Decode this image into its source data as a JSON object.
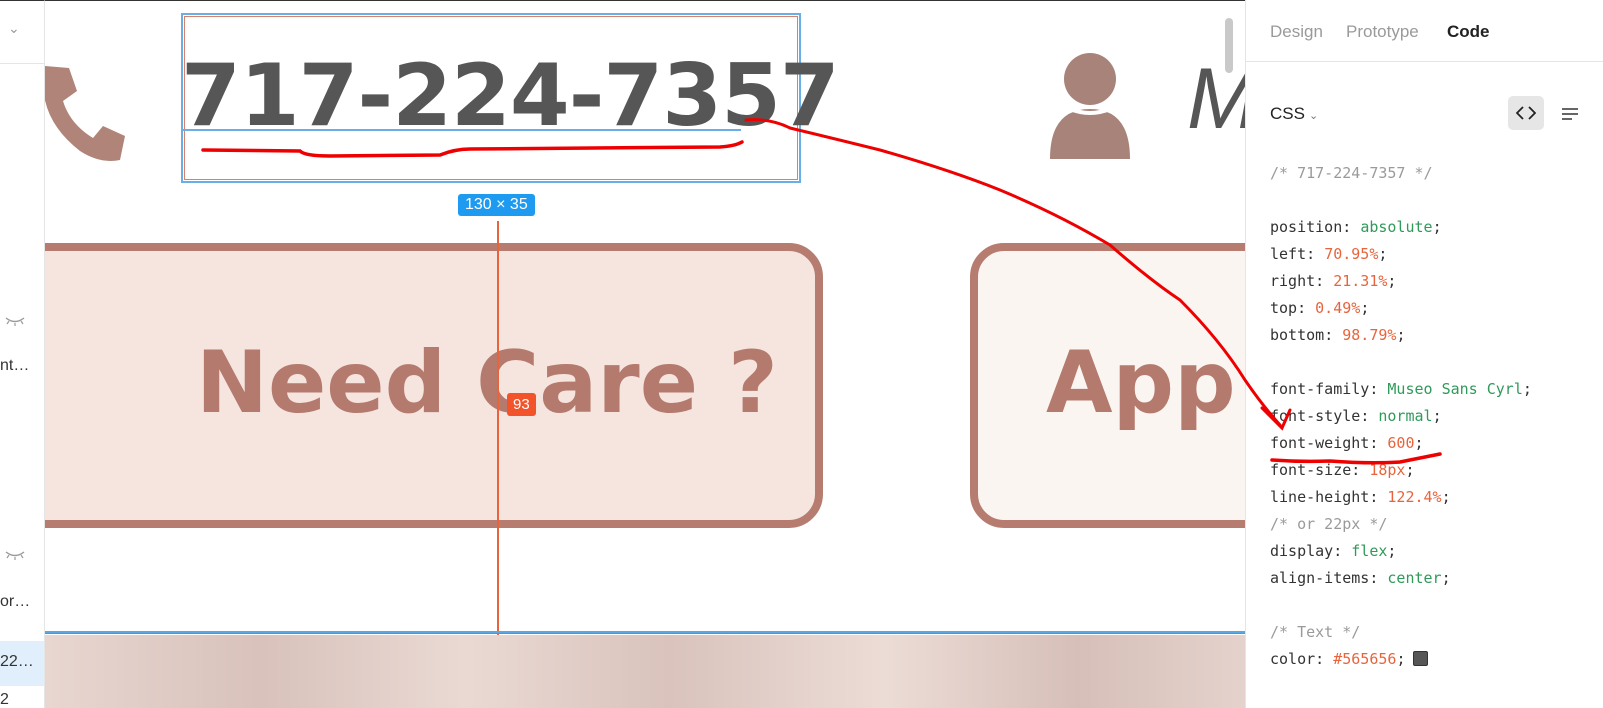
{
  "layers_panel": {
    "items": [
      "nt…",
      "or…",
      "22…",
      "2"
    ]
  },
  "canvas": {
    "phone_number": "717-224-7357",
    "size_badge": "130 × 35",
    "distance_badge": "93",
    "card_need_text": "Need Care ?",
    "card_app_text": "App",
    "cut_letter": "M"
  },
  "inspector": {
    "tabs": [
      {
        "label": "Design",
        "active": false
      },
      {
        "label": "Prototype",
        "active": false
      },
      {
        "label": "Code",
        "active": true
      }
    ],
    "language": "CSS",
    "code": {
      "comment_name": "/* 717-224-7357 */",
      "position": {
        "prop": "position",
        "value": "absolute"
      },
      "left": {
        "prop": "left",
        "value": "70.95%"
      },
      "right": {
        "prop": "right",
        "value": "21.31%"
      },
      "top": {
        "prop": "top",
        "value": "0.49%"
      },
      "bottom": {
        "prop": "bottom",
        "value": "98.79%"
      },
      "font_family": {
        "prop": "font-family",
        "value": "Museo Sans Cyrl"
      },
      "font_style": {
        "prop": "font-style",
        "value": "normal"
      },
      "font_weight": {
        "prop": "font-weight",
        "value": "600"
      },
      "font_size": {
        "prop": "font-size",
        "value": "18px"
      },
      "line_height": {
        "prop": "line-height",
        "value": "122.4%"
      },
      "comment_px": "/* or 22px */",
      "display": {
        "prop": "display",
        "value": "flex"
      },
      "align_items": {
        "prop": "align-items",
        "value": "center"
      },
      "comment_text": "/* Text */",
      "color": {
        "prop": "color",
        "value": "#565656"
      }
    }
  },
  "colors": {
    "text_gray": "#565656",
    "accent_brown": "#b57c6f",
    "selection_blue": "#1e9bf0",
    "measure_orange": "#f2532a",
    "annotation_red": "#ee0000"
  }
}
